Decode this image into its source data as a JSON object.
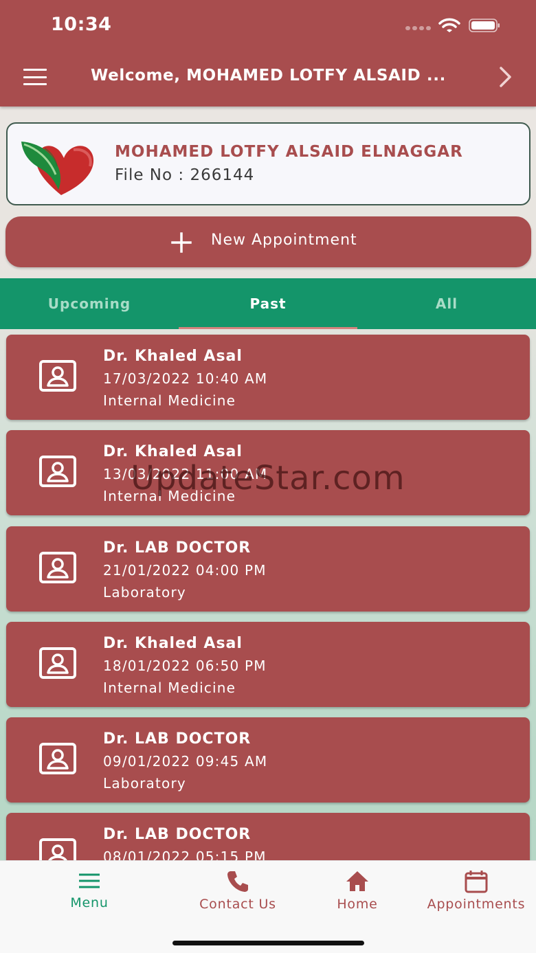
{
  "status_bar": {
    "time": "10:34"
  },
  "header": {
    "welcome": "Welcome, MOHAMED LOTFY ALSAID ..."
  },
  "patient": {
    "name": "MOHAMED LOTFY ALSAID ELNAGGAR",
    "file_no": "File No : 266144"
  },
  "new_appointment": {
    "label": "New Appointment"
  },
  "tabs": [
    {
      "label": "Upcoming",
      "active": false
    },
    {
      "label": "Past",
      "active": true
    },
    {
      "label": "All",
      "active": false
    }
  ],
  "appointments": [
    {
      "doctor": "Dr. Khaled Asal",
      "datetime": "17/03/2022 10:40 AM",
      "department": "Internal Medicine"
    },
    {
      "doctor": "Dr. Khaled Asal",
      "datetime": "13/03/2022 11:00 AM",
      "department": "Internal Medicine"
    },
    {
      "doctor": "Dr. LAB DOCTOR",
      "datetime": "21/01/2022 04:00 PM",
      "department": "Laboratory"
    },
    {
      "doctor": "Dr. Khaled Asal",
      "datetime": "18/01/2022 06:50 PM",
      "department": "Internal Medicine"
    },
    {
      "doctor": "Dr. LAB DOCTOR",
      "datetime": "09/01/2022 09:45 AM",
      "department": "Laboratory"
    },
    {
      "doctor": "Dr. LAB DOCTOR",
      "datetime": "08/01/2022 05:15 PM",
      "department": ""
    }
  ],
  "watermark": "UpdateStar.com",
  "bottom_nav": [
    {
      "label": "Menu",
      "icon": "menu-icon",
      "active": true
    },
    {
      "label": "Contact Us",
      "icon": "phone-icon",
      "active": false
    },
    {
      "label": "Home",
      "icon": "home-icon",
      "active": false
    },
    {
      "label": "Appointments",
      "icon": "calendar-icon",
      "active": false
    }
  ],
  "colors": {
    "primary": "#a84d4e",
    "accent": "#14956a",
    "tab_indicator": "#d5837d"
  }
}
